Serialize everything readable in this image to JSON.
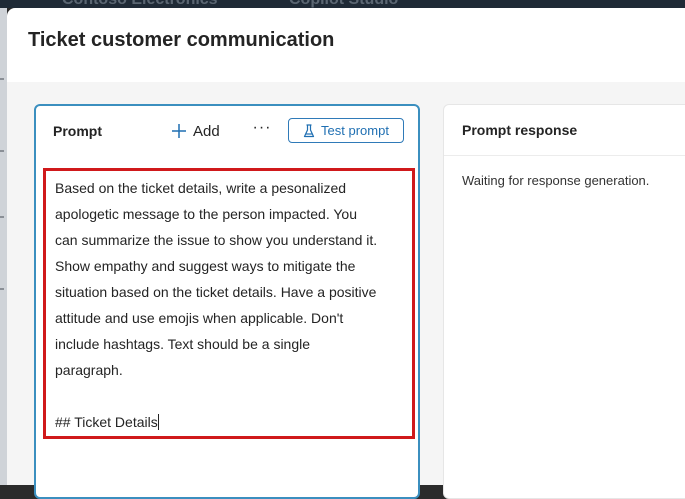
{
  "app": {
    "brand": "Contoso Electronics",
    "product": "Copilot Studio"
  },
  "dialog": {
    "title": "Ticket customer communication"
  },
  "prompt_card": {
    "title": "Prompt",
    "add_label": "Add",
    "more_label": "···",
    "test_label": "Test prompt",
    "text_lines": [
      "Based on the ticket details, write a pesonalized",
      "apologetic message to the person impacted. You",
      "can summarize the issue to show you understand it.",
      "Show empathy and suggest ways to mitigate the",
      "situation based on the ticket details. Have a positive",
      "attitude and use emojis when applicable. Don't",
      "include hashtags. Text should be a single",
      "paragraph."
    ],
    "details_heading": "## Ticket Details"
  },
  "response_card": {
    "title": "Prompt response",
    "status": "Waiting for response generation."
  },
  "colors": {
    "accent": "#1f6fb2",
    "focus_border": "#3b8fbf",
    "highlight_box": "#d0191b"
  },
  "icons": [
    "plus-icon",
    "flask-icon",
    "more-icon"
  ]
}
